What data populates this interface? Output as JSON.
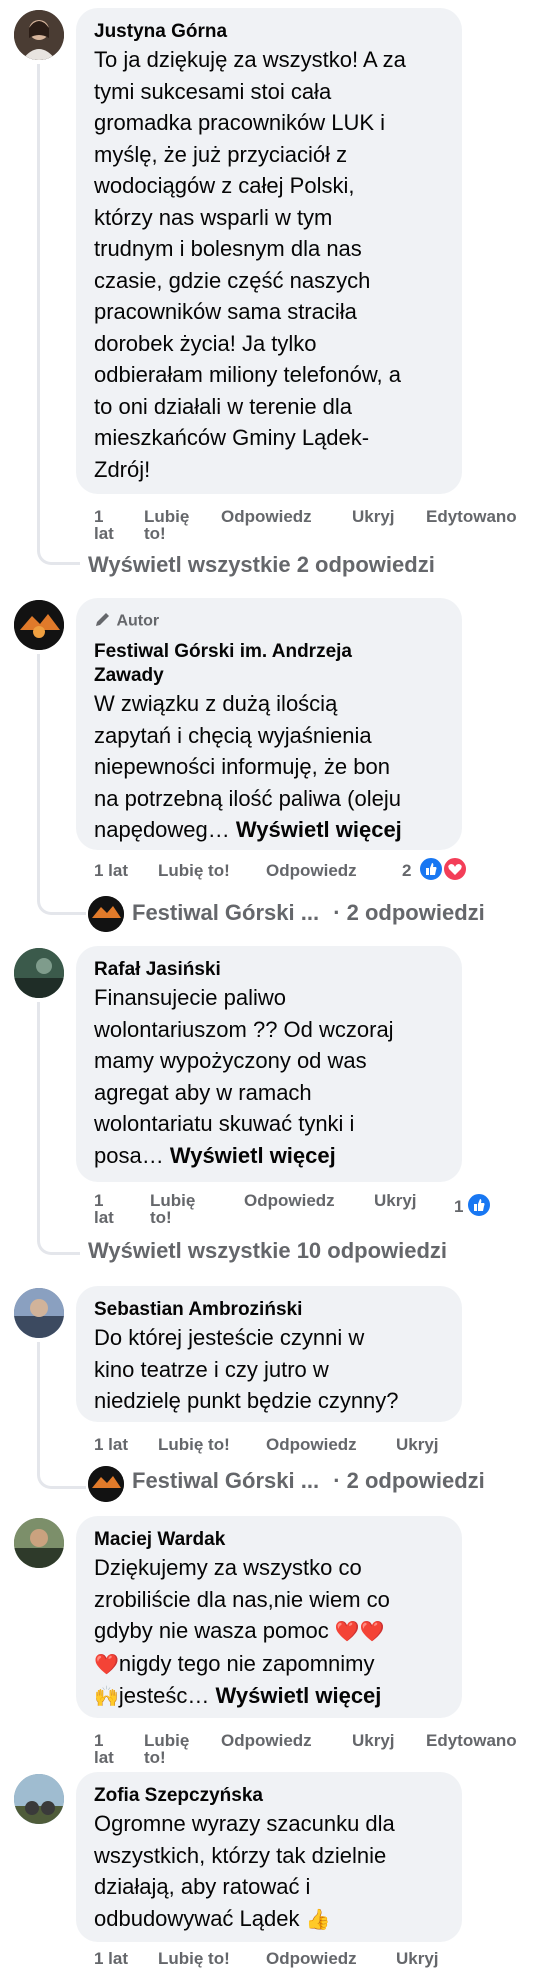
{
  "colors": {
    "bubble": "#f0f2f5",
    "meta_text": "#65676b",
    "like_blue": "#1877f2",
    "love_red": "#f33e58"
  },
  "comments": [
    {
      "name": "Justyna Górna",
      "text": "To ja dziękuję za wszystko! A za\ntymi sukcesami stoi cała\ngromadka pracowników LUK i\nmyślę, że już przyciaciół z\nwodociągów z całej Polski,\nktórzy nas wsparli w tym\ntrudnym i bolesnym dla nas\nczasie, gdzie część naszych\npracowników sama straciła\ndorobek życia! Ja tylko\nodbierałam miliony telefonów, a\nto oni działali w terenie dla\nmieszkańców Gminy Lądek-\nZdrój!",
      "actions": {
        "time_1": "1",
        "time_2": "lat",
        "like_1": "Lubię",
        "like_2": "to!",
        "reply": "Odpowiedz",
        "hide": "Ukryj",
        "edited": "Edytowano"
      },
      "view_replies": "Wyświetl wszystkie 2 odpowiedzi"
    },
    {
      "author_badge": "Autor",
      "name_line1": "Festiwal Górski im. Andrzeja",
      "name_line2": "Zawady",
      "text": "W związku z dużą ilością\nzapytań i chęcią wyjaśnienia\nniepewności informuję, że bon\nna potrzebną ilość paliwa (oleju\nnapędoweg…",
      "see_more": "Wyświetl więcej",
      "actions": {
        "time": "1 lat",
        "like": "Lubię to!",
        "reply": "Odpowiedz",
        "reactions": "2"
      },
      "reply_author": "Festiwal Górski ...",
      "reply_count": "· 2 odpowiedzi"
    },
    {
      "name": "Rafał Jasiński",
      "text": "Finansujecie paliwo\nwolontariuszom ?? Od wczoraj\nmamy wypożyczony od was\nagregat aby w ramach\nwolontariatu skuwać tynki i\nposa…",
      "see_more": "Wyświetl więcej",
      "actions": {
        "time_1": "1",
        "time_2": "lat",
        "like_1": "Lubię",
        "like_2": "to!",
        "reply": "Odpowiedz",
        "hide": "Ukryj",
        "reactions": "1"
      },
      "view_replies": "Wyświetl wszystkie 10 odpowiedzi"
    },
    {
      "name": "Sebastian Ambroziński",
      "text": "Do której jesteście czynni w\nkino teatrze i czy jutro w\nniedzielę punkt będzie czynny?",
      "actions": {
        "time": "1 lat",
        "like": "Lubię to!",
        "reply": "Odpowiedz",
        "hide": "Ukryj"
      },
      "reply_author": "Festiwal Górski ...",
      "reply_count": "· 2 odpowiedzi"
    },
    {
      "name": "Maciej Wardak",
      "line1": "Dziękujemy za wszystko co",
      "line2": "zrobiliście dla nas,nie wiem co",
      "line3": "gdyby nie wasza pomoc ",
      "hearts": "❤️❤️",
      "line4_heart": "❤️",
      "line4": "nigdy tego nie zapomnimy",
      "line5_hands": "🙌",
      "line5": "jesteśc…",
      "see_more": "Wyświetl więcej",
      "actions": {
        "time_1": "1",
        "time_2": "lat",
        "like_1": "Lubię",
        "like_2": "to!",
        "reply": "Odpowiedz",
        "hide": "Ukryj",
        "edited": "Edytowano"
      }
    },
    {
      "name": "Zofia Szepczyńska",
      "text": "Ogromne wyrazy szacunku dla\nwszystkich, którzy tak dzielnie\ndziałają, aby ratować i",
      "last_line": "odbudowywać Lądek ",
      "thumb": "👍",
      "actions": {
        "time": "1 lat",
        "like": "Lubię to!",
        "reply": "Odpowiedz",
        "hide": "Ukryj"
      }
    }
  ]
}
